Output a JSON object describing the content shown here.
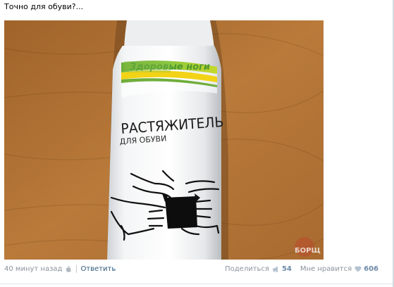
{
  "post": {
    "text": "Точно для обуви?..."
  },
  "photo": {
    "can_brand": "Здоровые ноги",
    "can_title": "РАСТЯЖИТЕЛЬ",
    "can_subtitle": "ДЛЯ ОБУВИ",
    "watermark": "БОРЩ"
  },
  "footer": {
    "time": "40 минут назад",
    "reply": "Ответить",
    "share_label": "Поделиться",
    "share_count": "54",
    "like_label": "Мне нравится",
    "like_count": "606"
  }
}
